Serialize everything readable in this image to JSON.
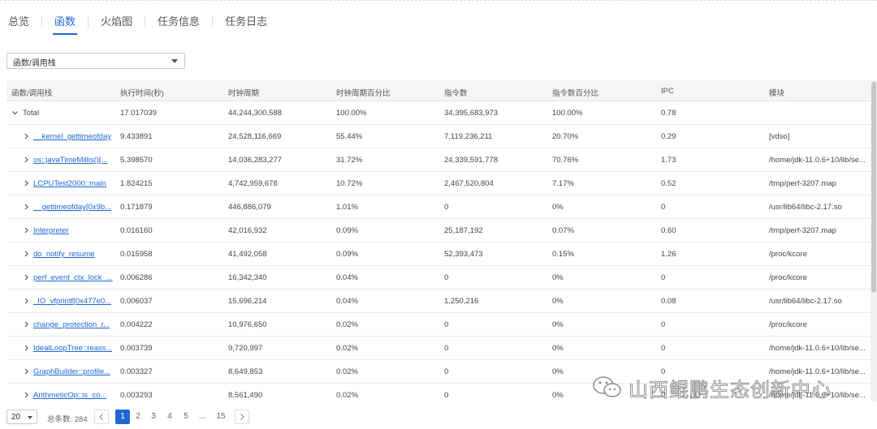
{
  "tabs": [
    "总览",
    "函数",
    "火焰图",
    "任务信息",
    "任务日志"
  ],
  "active_tab": 1,
  "view_select": {
    "value": "函数/调用栈"
  },
  "table": {
    "columns": [
      "函数/调用栈",
      "执行时间(秒)",
      "时钟周期",
      "时钟周期百分比",
      "指令数",
      "指令数百分比",
      "IPC",
      "模块"
    ],
    "total": {
      "name": "Total",
      "exec_time": "17.017039",
      "cycles": "44,244,300,588",
      "cycles_pct": "100.00%",
      "instructions": "34,395,683,973",
      "instr_pct": "100.00%",
      "ipc": "0.78",
      "module": ""
    },
    "rows": [
      {
        "name": "__kernel_gettimeofday",
        "exec_time": "9.433891",
        "cycles": "24,528,116,669",
        "cycles_pct": "55.44%",
        "instructions": "7,119,236,211",
        "instr_pct": "20.70%",
        "ipc": "0.29",
        "module": "[vdso]"
      },
      {
        "name": "os::javaTimeMillis()[...",
        "exec_time": "5.398570",
        "cycles": "14,036,283,277",
        "cycles_pct": "31.72%",
        "instructions": "24,339,591,778",
        "instr_pct": "70.76%",
        "ipc": "1.73",
        "module": "/home/jdk-11.0.6+10/lib/se..."
      },
      {
        "name": "LCPUTest2000::main",
        "exec_time": "1.824215",
        "cycles": "4,742,959,678",
        "cycles_pct": "10.72%",
        "instructions": "2,467,520,804",
        "instr_pct": "7.17%",
        "ipc": "0.52",
        "module": "/tmp/perf-3207.map"
      },
      {
        "name": "__gettimeofday[0x9b...",
        "exec_time": "0.171879",
        "cycles": "446,886,079",
        "cycles_pct": "1.01%",
        "instructions": "0",
        "instr_pct": "0%",
        "ipc": "0",
        "module": "/usr/lib64/libc-2.17.so"
      },
      {
        "name": "Interpreter",
        "exec_time": "0.016160",
        "cycles": "42,016,932",
        "cycles_pct": "0.09%",
        "instructions": "25,187,192",
        "instr_pct": "0.07%",
        "ipc": "0.60",
        "module": "/tmp/perf-3207.map"
      },
      {
        "name": "do_notify_resume",
        "exec_time": "0.015958",
        "cycles": "41,492,058",
        "cycles_pct": "0.09%",
        "instructions": "52,393,473",
        "instr_pct": "0.15%",
        "ipc": "1.26",
        "module": "/proc/kcore"
      },
      {
        "name": "perf_event_ctx_lock_...",
        "exec_time": "0.006286",
        "cycles": "16,342,340",
        "cycles_pct": "0.04%",
        "instructions": "0",
        "instr_pct": "0%",
        "ipc": "0",
        "module": "/proc/kcore"
      },
      {
        "name": "_IO_vfprintf[0x477e0...",
        "exec_time": "0.006037",
        "cycles": "15,696,214",
        "cycles_pct": "0.04%",
        "instructions": "1,250,216",
        "instr_pct": "0%",
        "ipc": "0.08",
        "module": "/usr/lib64/libc-2.17.so"
      },
      {
        "name": "change_protection_r...",
        "exec_time": "0.004222",
        "cycles": "10,976,650",
        "cycles_pct": "0.02%",
        "instructions": "0",
        "instr_pct": "0%",
        "ipc": "0",
        "module": "/proc/kcore"
      },
      {
        "name": "IdealLoopTree::reass...",
        "exec_time": "0.003739",
        "cycles": "9,720,997",
        "cycles_pct": "0.02%",
        "instructions": "0",
        "instr_pct": "0%",
        "ipc": "0",
        "module": "/home/jdk-11.0.6+10/lib/se..."
      },
      {
        "name": "GraphBuilder::profile...",
        "exec_time": "0.003327",
        "cycles": "8,649,853",
        "cycles_pct": "0.02%",
        "instructions": "0",
        "instr_pct": "0%",
        "ipc": "0",
        "module": "/home/jdk-11.0.6+10/lib/se..."
      },
      {
        "name": "ArithmeticOp::is_co...",
        "exec_time": "0.003293",
        "cycles": "8,561,490",
        "cycles_pct": "0.02%",
        "instructions": "0",
        "instr_pct": "0%",
        "ipc": "0",
        "module": "/home/jdk-11.0.6+10/lib/se..."
      }
    ]
  },
  "pagination": {
    "page_size": "20",
    "total_label": "总条数: 284",
    "pages": [
      "1",
      "2",
      "3",
      "4",
      "5",
      "...",
      "15"
    ],
    "current": "1"
  },
  "watermark": {
    "text": "山西鲲鹏生态创新中心",
    "icon": "wechat-icon"
  },
  "colors": {
    "accent": "#1f67d4"
  }
}
